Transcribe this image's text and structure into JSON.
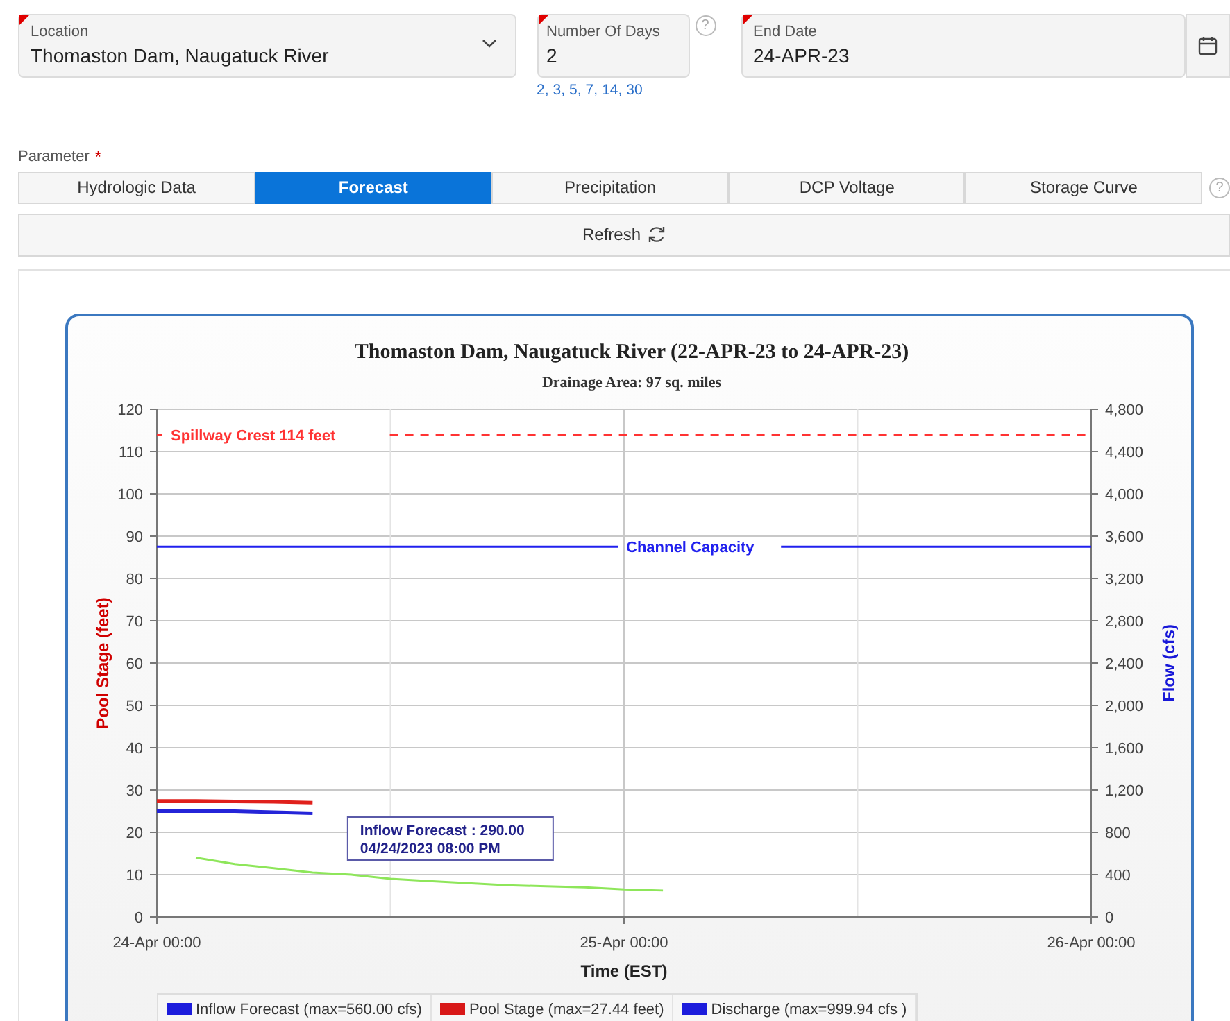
{
  "form": {
    "location": {
      "label": "Location",
      "value": "Thomaston Dam, Naugatuck River",
      "required": true
    },
    "days": {
      "label": "Number Of Days",
      "value": "2",
      "required": true,
      "help": "?"
    },
    "day_links": [
      "2,",
      "3,",
      "5,",
      "7,",
      "14,",
      "30"
    ],
    "end_date": {
      "label": "End Date",
      "value": "24-APR-23",
      "required": true
    }
  },
  "parameter": {
    "label": "Parameter",
    "required_mark": "*",
    "help": "?",
    "tabs": [
      {
        "label": "Hydrologic Data",
        "selected": false
      },
      {
        "label": "Forecast",
        "selected": true
      },
      {
        "label": "Precipitation",
        "selected": false
      },
      {
        "label": "DCP Voltage",
        "selected": false
      },
      {
        "label": "Storage Curve",
        "selected": false
      }
    ]
  },
  "refresh_button": {
    "label": "Refresh"
  },
  "chart": {
    "chart_data": {
      "type": "line",
      "title": "Thomaston Dam, Naugatuck River (22-APR-23 to 24-APR-23)",
      "subtitle": "Drainage Area: 97 sq. miles",
      "xlabel": "Time (EST)",
      "ylabel": "Pool Stage (feet)",
      "y2label": "Flow (cfs)",
      "categories": [
        "24-Apr 00:00",
        null,
        null,
        null,
        null,
        null,
        null,
        null,
        null,
        null,
        null,
        null,
        "25-Apr 00:00",
        null,
        null,
        null,
        null,
        null,
        null,
        null,
        null,
        null,
        null,
        null,
        "26-Apr 00:00"
      ],
      "ylim": [
        0,
        120
      ],
      "y2lim": [
        0,
        4800
      ],
      "grid": true,
      "ref_lines": [
        {
          "value": 114,
          "axis": "y",
          "label": "Spillway Crest 114 feet",
          "color": "#ff3333"
        },
        {
          "value": 3500,
          "axis": "y2",
          "label": "Channel Capacity",
          "color": "#2020ee"
        }
      ],
      "yticks": [
        0,
        10,
        20,
        30,
        40,
        50,
        60,
        70,
        80,
        90,
        100,
        110,
        120
      ],
      "y2ticks": [
        {
          "value": 0,
          "label": "0"
        },
        {
          "value": 400,
          "label": "400"
        },
        {
          "value": 800,
          "label": "800"
        },
        {
          "value": 1200,
          "label": "1,200"
        },
        {
          "value": 1600,
          "label": "1,600"
        },
        {
          "value": 2000,
          "label": "2,000"
        },
        {
          "value": 2400,
          "label": "2,400"
        },
        {
          "value": 2800,
          "label": "2,800"
        },
        {
          "value": 3200,
          "label": "3,200"
        },
        {
          "value": 3600,
          "label": "3,600"
        },
        {
          "value": 4000,
          "label": "4,000"
        },
        {
          "value": 4400,
          "label": "4,400"
        },
        {
          "value": 4800,
          "label": "4,800"
        }
      ],
      "series": [
        {
          "name": "Inflow Forecast",
          "color": "#8ee65a",
          "axis": "y2",
          "values": [
            null,
            560,
            500,
            460,
            420,
            400,
            360,
            340,
            320,
            300,
            290,
            280,
            260,
            250,
            null,
            null,
            null,
            null,
            null,
            null,
            null,
            null,
            null,
            null,
            null
          ]
        },
        {
          "name": "Pool Stage",
          "color": "#e0201c",
          "values": [
            27.4,
            27.4,
            27.3,
            27.2,
            27.0,
            null,
            null,
            null,
            null,
            null,
            null,
            null,
            null,
            null,
            null,
            null,
            null,
            null,
            null,
            null,
            null,
            null,
            null,
            null,
            null
          ]
        },
        {
          "name": "Discharge",
          "color": "#2424d8",
          "axis": "y2",
          "values": [
            1000,
            1000,
            1000,
            990,
            980,
            null,
            null,
            null,
            null,
            null,
            null,
            null,
            null,
            null,
            null,
            null,
            null,
            null,
            null,
            null,
            null,
            null,
            null,
            null,
            null
          ]
        }
      ]
    },
    "tooltip": {
      "lines": [
        "Inflow Forecast : 290.00",
        "04/24/2023 08:00 PM"
      ]
    },
    "legend": [
      {
        "detail": "(max=560.00 cfs)",
        "color": "#1c1cdc"
      },
      {
        "detail": "(max=27.44 feet)",
        "color": "#d81818"
      },
      {
        "detail": "(max=999.94 cfs )",
        "color": "#1c1cdc"
      }
    ]
  }
}
